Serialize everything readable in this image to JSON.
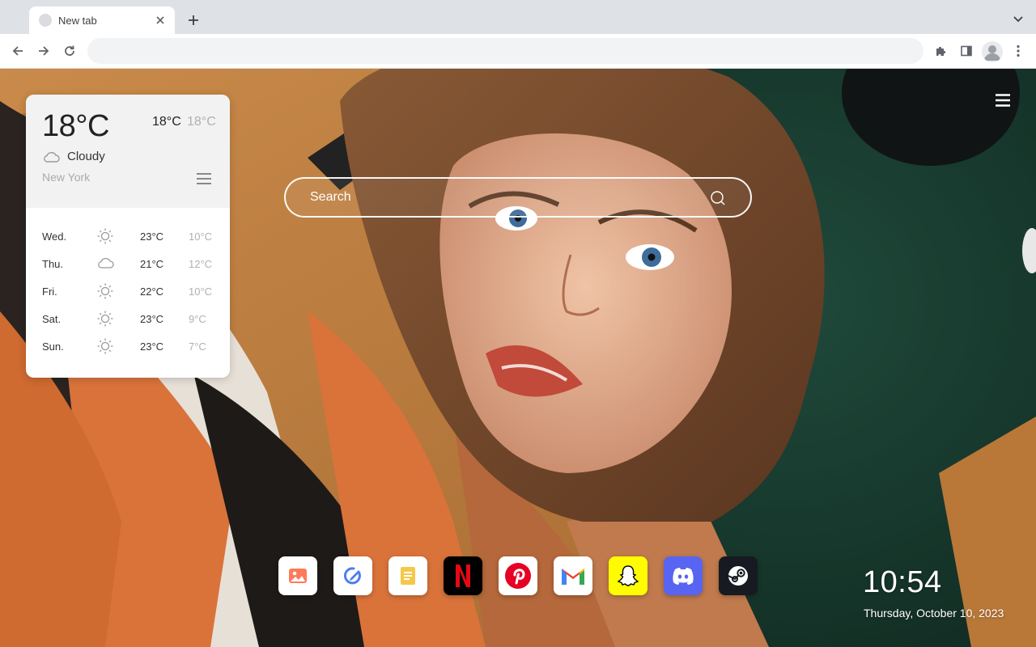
{
  "browser": {
    "tab_title": "New tab",
    "omnibox_value": "",
    "omnibox_placeholder": ""
  },
  "weather": {
    "current_temp": "18°C",
    "high": "18°C",
    "low": "18°C",
    "condition": "Cloudy",
    "condition_icon": "cloud-icon",
    "city": "New York",
    "forecast": [
      {
        "day": "Wed.",
        "icon": "sun-icon",
        "high": "23°C",
        "low": "10°C"
      },
      {
        "day": "Thu.",
        "icon": "cloud-icon",
        "high": "21°C",
        "low": "12°C"
      },
      {
        "day": "Fri.",
        "icon": "sun-icon",
        "high": "22°C",
        "low": "10°C"
      },
      {
        "day": "Sat.",
        "icon": "sun-icon",
        "high": "23°C",
        "low": "9°C"
      },
      {
        "day": "Sun.",
        "icon": "sun-icon",
        "high": "23°C",
        "low": "7°C"
      }
    ]
  },
  "search": {
    "placeholder": "Search"
  },
  "shortcuts": [
    {
      "name": "gallery",
      "icon": "image-icon"
    },
    {
      "name": "draw",
      "icon": "pen-circle-icon"
    },
    {
      "name": "notes",
      "icon": "notepad-icon"
    },
    {
      "name": "netflix",
      "icon": "netflix-icon"
    },
    {
      "name": "pinterest",
      "icon": "pinterest-icon"
    },
    {
      "name": "gmail",
      "icon": "gmail-icon"
    },
    {
      "name": "snapchat",
      "icon": "snapchat-icon"
    },
    {
      "name": "discord",
      "icon": "discord-icon"
    },
    {
      "name": "steam",
      "icon": "steam-icon"
    }
  ],
  "clock": {
    "time": "10:54",
    "date": "Thursday, October 10, 2023"
  },
  "colors": {
    "netflix_red": "#e50914",
    "pinterest_red": "#e60023",
    "snapchat_yellow": "#fffc00",
    "discord_blurple": "#5865f2",
    "steam_dark": "#171a21"
  }
}
